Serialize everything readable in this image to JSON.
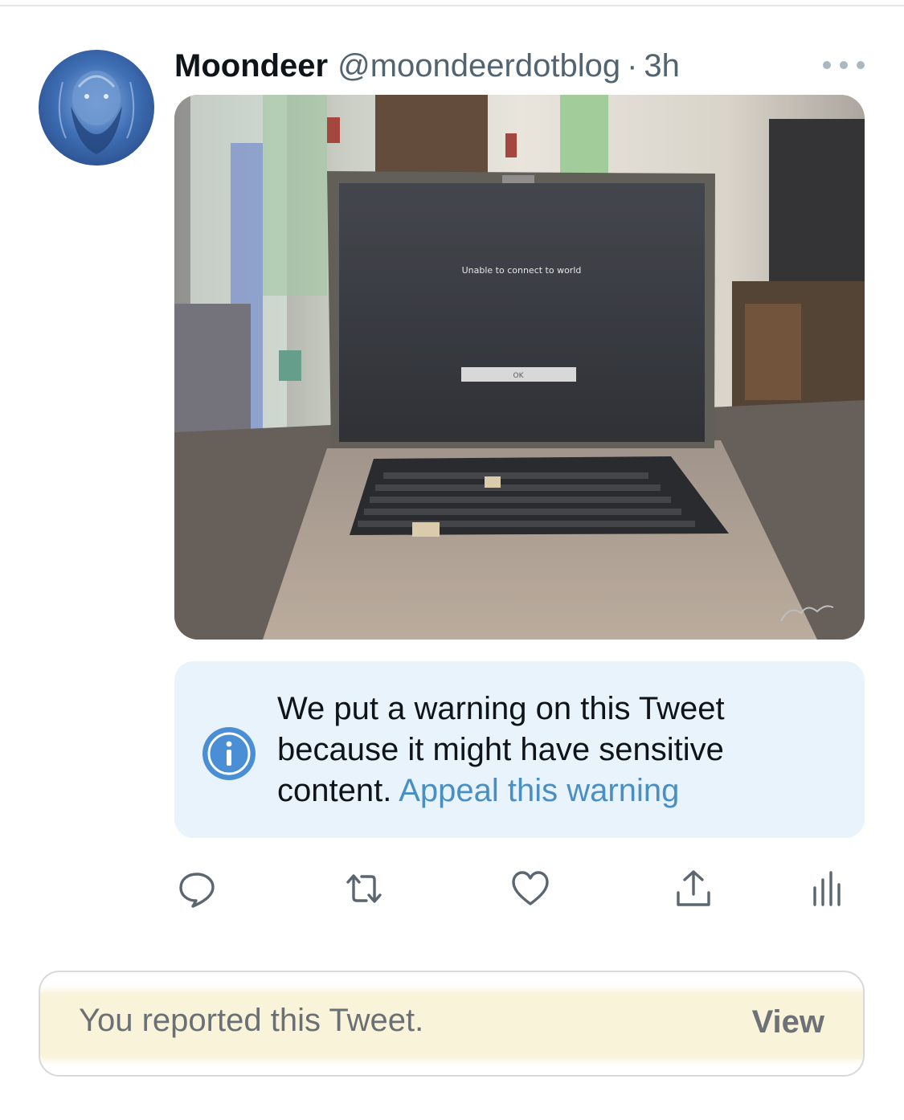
{
  "tweet": {
    "display_name": "Moondeer",
    "handle": "@moondeerdotblog",
    "separator": "·",
    "time": "3h",
    "more_icon": "more-horizontal-icon",
    "avatar": "avatar-image"
  },
  "media": {
    "screen_text": "Unable to connect to world",
    "dialog_button": "OK"
  },
  "warning": {
    "icon": "info-icon",
    "text": "We put a warning on this Tweet because it might have sensitive content.",
    "appeal_link": "Appeal this warning",
    "background": "#e8f3fc",
    "link_color": "#4a8fc4"
  },
  "actions": [
    {
      "name": "reply",
      "icon": "reply-icon"
    },
    {
      "name": "retweet",
      "icon": "retweet-icon"
    },
    {
      "name": "like",
      "icon": "heart-icon"
    },
    {
      "name": "share",
      "icon": "share-icon"
    },
    {
      "name": "analytics",
      "icon": "analytics-icon"
    }
  ],
  "report": {
    "text": "You reported this Tweet.",
    "view_label": "View",
    "highlight_color": "#f9f3da"
  }
}
